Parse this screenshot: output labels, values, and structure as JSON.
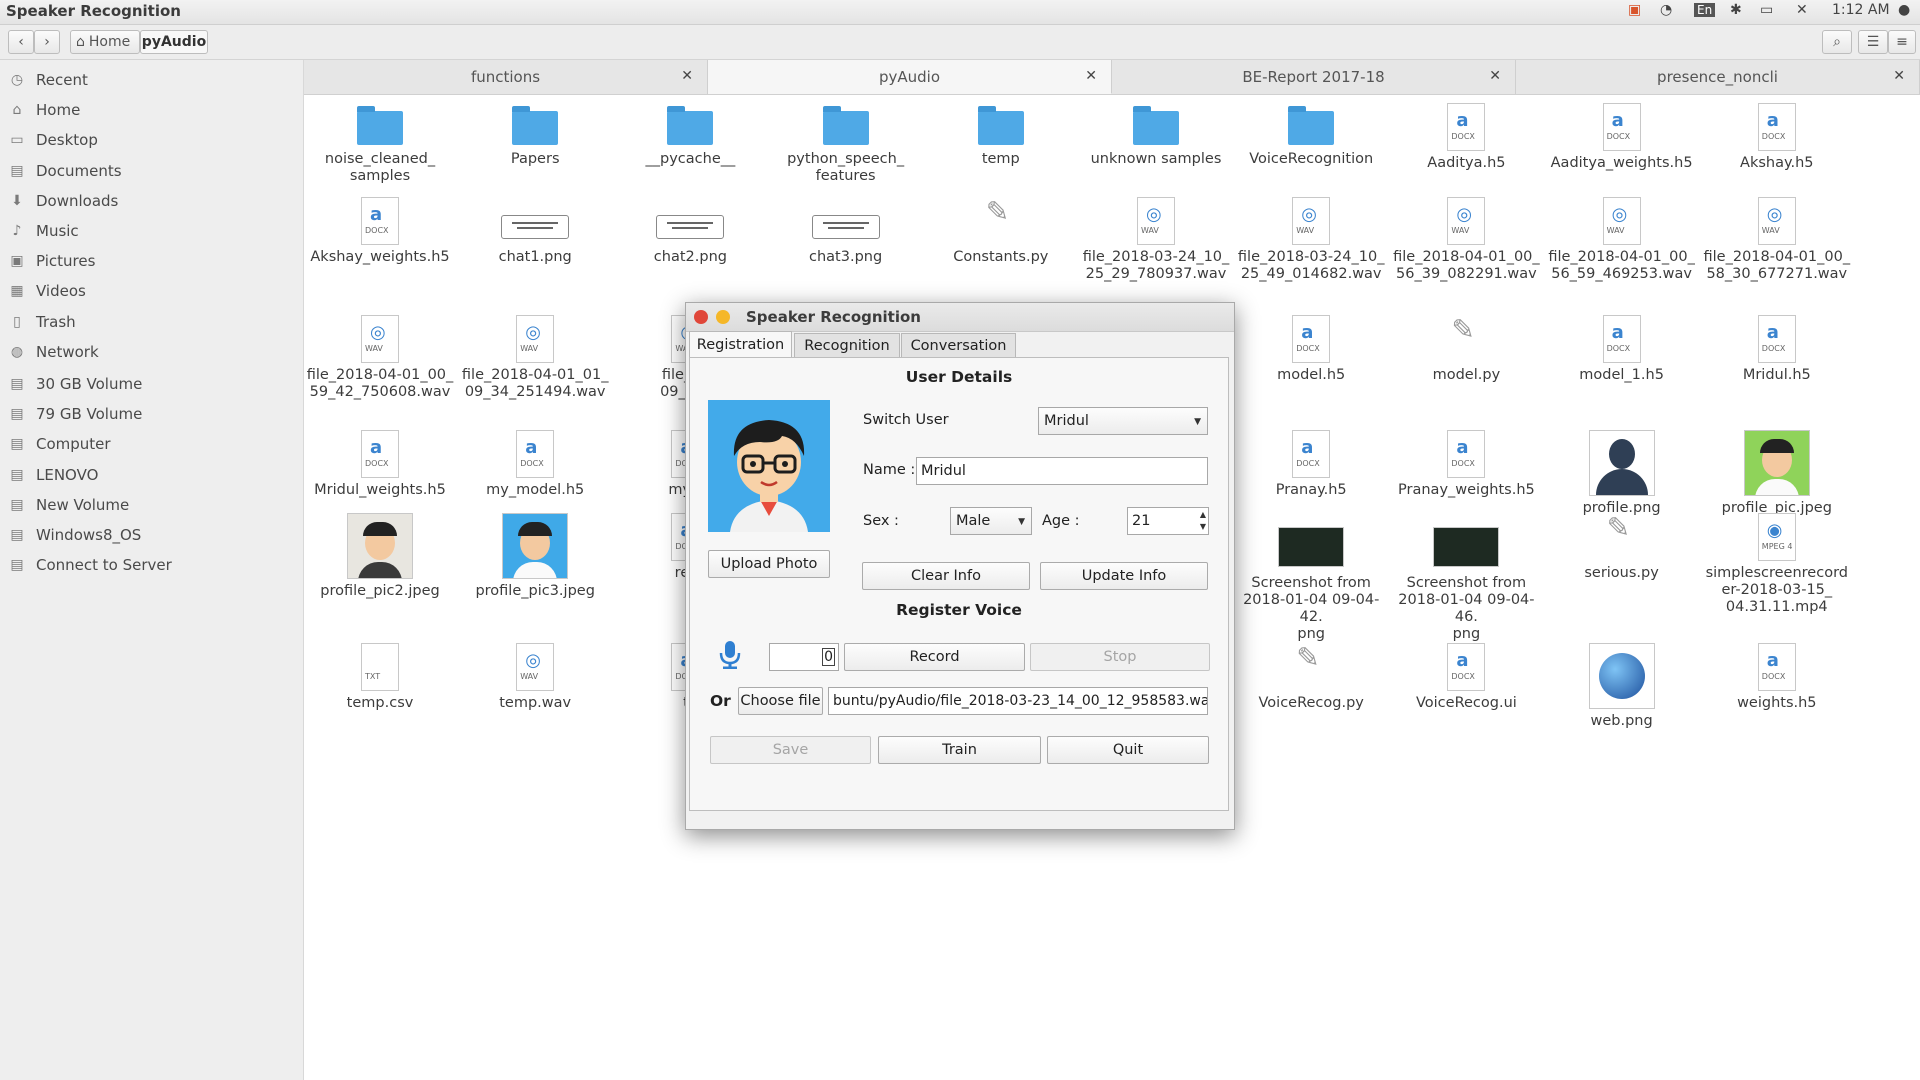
{
  "topbar": {
    "app_title": "Speaker Recognition",
    "keyboard_layout": "En",
    "time": "1:12 AM"
  },
  "toolbar": {
    "path": [
      "Home",
      "pyAudio"
    ]
  },
  "sidebar": {
    "places": [
      {
        "label": "Recent",
        "icon": "clock-icon"
      },
      {
        "label": "Home",
        "icon": "home-icon"
      },
      {
        "label": "Desktop",
        "icon": "desktop-icon"
      },
      {
        "label": "Documents",
        "icon": "documents-icon"
      },
      {
        "label": "Downloads",
        "icon": "downloads-icon"
      },
      {
        "label": "Music",
        "icon": "music-icon"
      },
      {
        "label": "Pictures",
        "icon": "pictures-icon"
      },
      {
        "label": "Videos",
        "icon": "videos-icon"
      },
      {
        "label": "Trash",
        "icon": "trash-icon"
      },
      {
        "label": "Network",
        "icon": "network-icon"
      }
    ],
    "devices": [
      {
        "label": "30 GB Volume"
      },
      {
        "label": "79 GB Volume"
      },
      {
        "label": "Computer"
      },
      {
        "label": "LENOVO"
      },
      {
        "label": "New Volume"
      },
      {
        "label": "Windows8_OS"
      },
      {
        "label": "Connect to Server"
      }
    ]
  },
  "tabs": [
    "functions",
    "pyAudio",
    "BE-Report 2017-18",
    "presence_noncli"
  ],
  "active_tab": 1,
  "files": [
    {
      "name": "noise_cleaned_\nsamples",
      "kind": "folder"
    },
    {
      "name": "Papers",
      "kind": "folder"
    },
    {
      "name": "__pycache__",
      "kind": "folder"
    },
    {
      "name": "python_speech_\nfeatures",
      "kind": "folder"
    },
    {
      "name": "temp",
      "kind": "folder"
    },
    {
      "name": "unknown samples",
      "kind": "folder"
    },
    {
      "name": "VoiceRecognition",
      "kind": "folder"
    },
    {
      "name": "Aaditya.h5",
      "kind": "doc"
    },
    {
      "name": "Aaditya_weights.h5",
      "kind": "doc"
    },
    {
      "name": "Akshay.h5",
      "kind": "doc"
    },
    {
      "name": "Akshay_weights.h5",
      "kind": "doc"
    },
    {
      "name": "chat1.png",
      "kind": "chatimg"
    },
    {
      "name": "chat2.png",
      "kind": "chatimg"
    },
    {
      "name": "chat3.png",
      "kind": "chatimg"
    },
    {
      "name": "Constants.py",
      "kind": "py"
    },
    {
      "name": "file_2018-03-24_10_\n25_29_780937.wav",
      "kind": "wav"
    },
    {
      "name": "file_2018-03-24_10_\n25_49_014682.wav",
      "kind": "wav"
    },
    {
      "name": "file_2018-04-01_00_\n56_39_082291.wav",
      "kind": "wav"
    },
    {
      "name": "file_2018-04-01_00_\n56_59_469253.wav",
      "kind": "wav"
    },
    {
      "name": "file_2018-04-01_00_\n58_30_677271.wav",
      "kind": "wav"
    },
    {
      "name": "file_2018-04-01_00_\n59_42_750608.wav",
      "kind": "wav"
    },
    {
      "name": "file_2018-04-01_01_\n09_34_251494.wav",
      "kind": "wav"
    },
    {
      "name": "file_201\n09_57_4",
      "kind": "wav"
    },
    {
      "name": "model.h5",
      "kind": "doc"
    },
    {
      "name": "model.py",
      "kind": "py"
    },
    {
      "name": "model_1.h5",
      "kind": "doc"
    },
    {
      "name": "Mridul.h5",
      "kind": "doc"
    },
    {
      "name": "Mridul_weights.h5",
      "kind": "doc"
    },
    {
      "name": "my_model.h5",
      "kind": "doc"
    },
    {
      "name": "my_m",
      "kind": "doc"
    },
    {
      "name": "Pranay.h5",
      "kind": "doc"
    },
    {
      "name": "Pranay_weights.h5",
      "kind": "doc"
    },
    {
      "name": "profile.png",
      "kind": "profile"
    },
    {
      "name": "profile_pic.jpeg",
      "kind": "avatar-green"
    },
    {
      "name": "profile_pic2.jpeg",
      "kind": "avatar-bean"
    },
    {
      "name": "profile_pic3.jpeg",
      "kind": "avatar-blue"
    },
    {
      "name": "reac",
      "kind": "doc"
    },
    {
      "name": "Screenshot from\n2018-01-04 09-04-42.\npng",
      "kind": "screenshot"
    },
    {
      "name": "Screenshot from\n2018-01-04 09-04-46.\npng",
      "kind": "screenshot"
    },
    {
      "name": "serious.py",
      "kind": "py"
    },
    {
      "name": "simplescreenrecord\ner-2018-03-15_\n04.31.11.mp4",
      "kind": "mpeg"
    },
    {
      "name": "temp.csv",
      "kind": "txt"
    },
    {
      "name": "temp.wav",
      "kind": "wav"
    },
    {
      "name": "te",
      "kind": "doc"
    },
    {
      "name": "VoiceRecog.py",
      "kind": "py"
    },
    {
      "name": "VoiceRecog.ui",
      "kind": "doc"
    },
    {
      "name": "web.png",
      "kind": "globe"
    },
    {
      "name": "weights.h5",
      "kind": "doc"
    }
  ],
  "icon_tags": {
    "doc": "DOCX",
    "wav": "WAV",
    "txt": "TXT",
    "mpeg": "MPEG 4"
  },
  "dialog": {
    "title": "Speaker Recognition",
    "tabs": [
      "Registration",
      "Recognition",
      "Conversation"
    ],
    "user_details_heading": "User Details",
    "switch_user_label": "Switch User",
    "switch_user_value": "Mridul",
    "name_label": "Name :",
    "name_value": "Mridul",
    "sex_label": "Sex :",
    "sex_value": "Male",
    "age_label": "Age :",
    "age_value": "21",
    "upload_photo": "Upload Photo",
    "clear_info": "Clear Info",
    "update_info": "Update Info",
    "register_voice_heading": "Register Voice",
    "counter_value": "0",
    "record": "Record",
    "stop": "Stop",
    "or_label": "Or",
    "choose_file": "Choose file",
    "file_path": "buntu/pyAudio/file_2018-03-23_14_00_12_958583.wav",
    "save": "Save",
    "train": "Train",
    "quit": "Quit"
  },
  "colors": {
    "folder": "#4fa9e6",
    "close_dot": "#e0473a",
    "min_dot": "#f5b728",
    "mic": "#2f7fd1"
  }
}
